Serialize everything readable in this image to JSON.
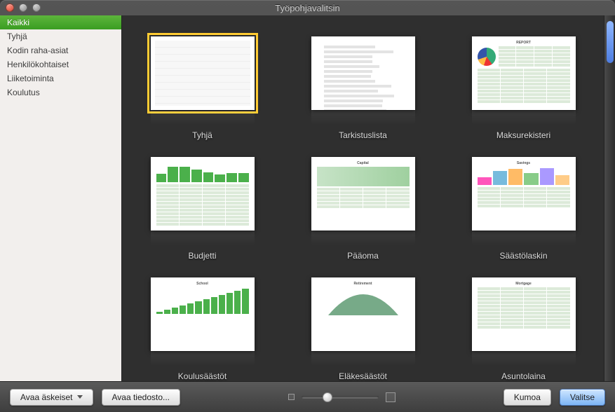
{
  "window": {
    "title": "Työpohjavalitsin"
  },
  "sidebar": {
    "items": [
      {
        "label": "Kaikki",
        "selected": true
      },
      {
        "label": "Tyhjä"
      },
      {
        "label": "Kodin raha-asiat"
      },
      {
        "label": "Henkilökohtaiset"
      },
      {
        "label": "Liiketoiminta"
      },
      {
        "label": "Koulutus"
      }
    ]
  },
  "templates": [
    {
      "label": "Tyhjä",
      "kind": "blank",
      "selected": true
    },
    {
      "label": "Tarkistuslista",
      "kind": "checklist"
    },
    {
      "label": "Maksurekisteri",
      "kind": "register"
    },
    {
      "label": "Budjetti",
      "kind": "budget"
    },
    {
      "label": "Pääoma",
      "kind": "capital"
    },
    {
      "label": "Säästölaskin",
      "kind": "savings"
    },
    {
      "label": "Koulusäästöt",
      "kind": "school"
    },
    {
      "label": "Eläkesäästöt",
      "kind": "retirement"
    },
    {
      "label": "Asuntolaina",
      "kind": "mortgage"
    }
  ],
  "buttons": {
    "open_recent": "Avaa äskeiset",
    "open_file": "Avaa tiedosto...",
    "cancel": "Kumoa",
    "choose": "Valitse"
  }
}
